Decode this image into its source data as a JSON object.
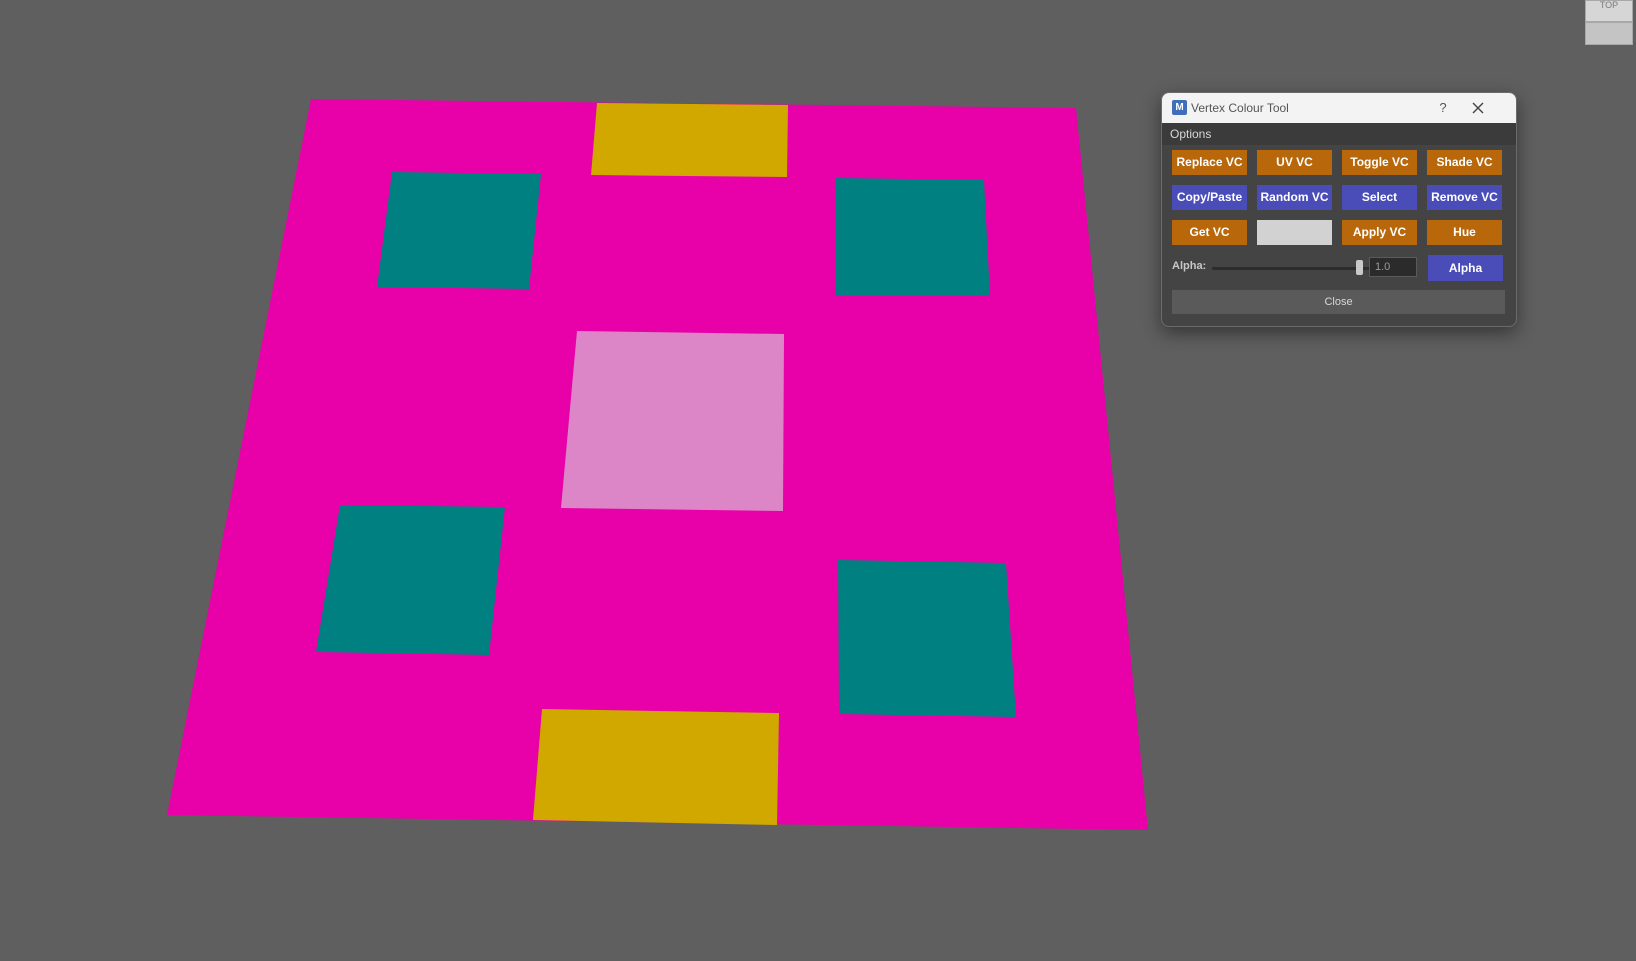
{
  "viewport": {
    "background": "#5f5f5f",
    "plane_color": "#e800a8",
    "teal_color": "#008080",
    "gold_color": "#d0a800",
    "light_pink_color": "#dc86c8",
    "view_cube": {
      "top_label": "TOP"
    }
  },
  "dialog": {
    "title": "Vertex Colour Tool",
    "help_label": "?",
    "menu": {
      "options_label": "Options"
    },
    "buttons": {
      "replace_vc": "Replace VC",
      "uv_vc": "UV VC",
      "toggle_vc": "Toggle VC",
      "shade_vc": "Shade VC",
      "copy_paste": "Copy/Paste",
      "random_vc": "Random VC",
      "select": "Select",
      "remove_vc": "Remove VC",
      "get_vc": "Get VC",
      "apply_vc": "Apply VC",
      "hue": "Hue",
      "alpha": "Alpha",
      "close": "Close"
    },
    "colour_swatch": "#d2d2d2",
    "alpha": {
      "label": "Alpha:",
      "value": "1.0",
      "slider_level": 1.0
    },
    "colors": {
      "orange": "#b8680a",
      "blue": "#4a4db8"
    }
  }
}
